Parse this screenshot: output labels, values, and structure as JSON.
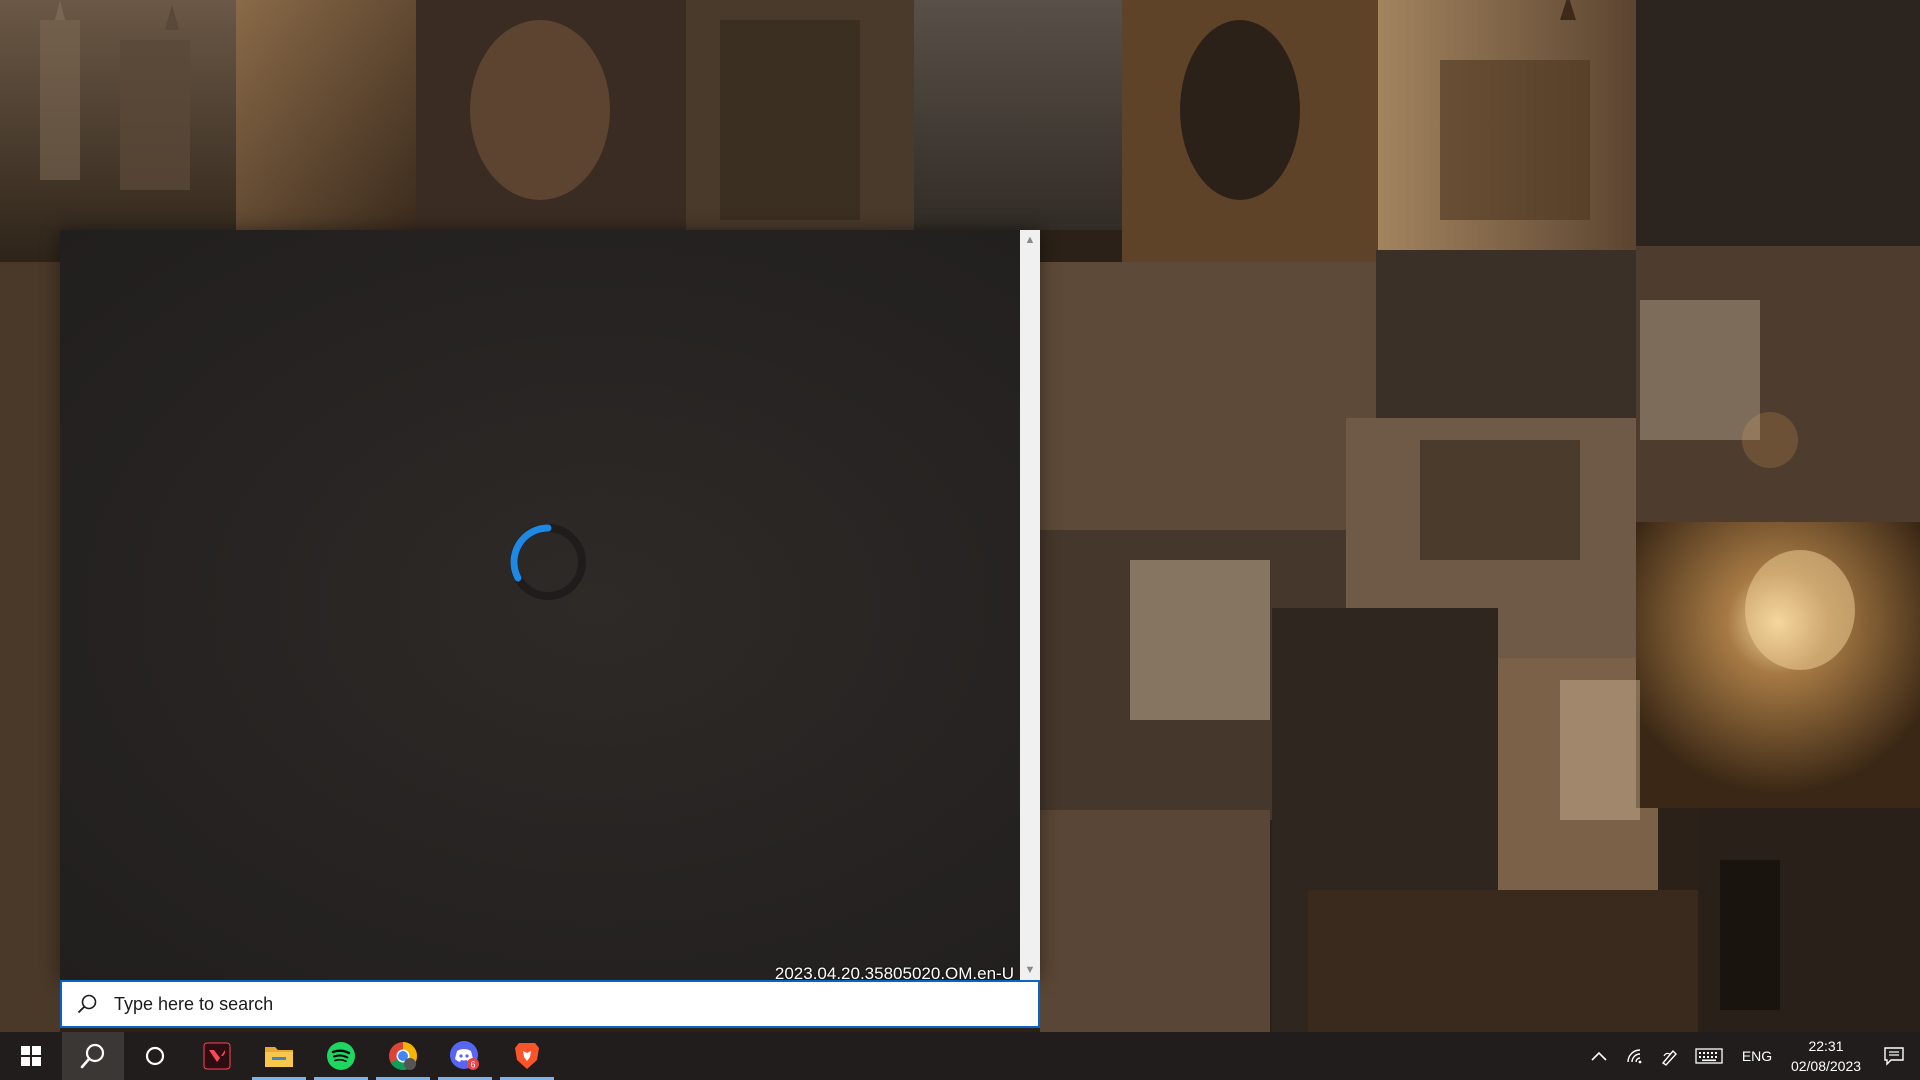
{
  "search": {
    "placeholder": "Type here to search"
  },
  "flyout": {
    "version_text": "2023.04.20.35805020.OM.en-U"
  },
  "taskbar": {
    "apps": [
      {
        "name": "start",
        "icon": "windows-logo-icon"
      },
      {
        "name": "search",
        "icon": "search-icon",
        "active": true
      },
      {
        "name": "cortana",
        "icon": "cortana-circle-icon"
      },
      {
        "name": "valorant",
        "icon": "valorant-icon",
        "accent": "#ff4655"
      },
      {
        "name": "file-explorer",
        "icon": "folder-icon",
        "accent": "#f8c74b",
        "running": true
      },
      {
        "name": "spotify",
        "icon": "spotify-icon",
        "accent": "#1ed760",
        "running": true
      },
      {
        "name": "chrome",
        "icon": "chrome-icon",
        "running": true
      },
      {
        "name": "discord",
        "icon": "discord-icon",
        "accent": "#5865f2",
        "running": true,
        "badge": "6"
      },
      {
        "name": "brave",
        "icon": "brave-icon",
        "accent": "#fb542b",
        "running": true
      }
    ],
    "tray": {
      "language": "ENG",
      "time": "22:31",
      "date": "02/08/2023"
    }
  },
  "colors": {
    "spinner": "#1e88e5",
    "search_border": "#0b63c8",
    "taskbar_bg": "#201d1c",
    "running_indicator": "#7cb3e8"
  }
}
